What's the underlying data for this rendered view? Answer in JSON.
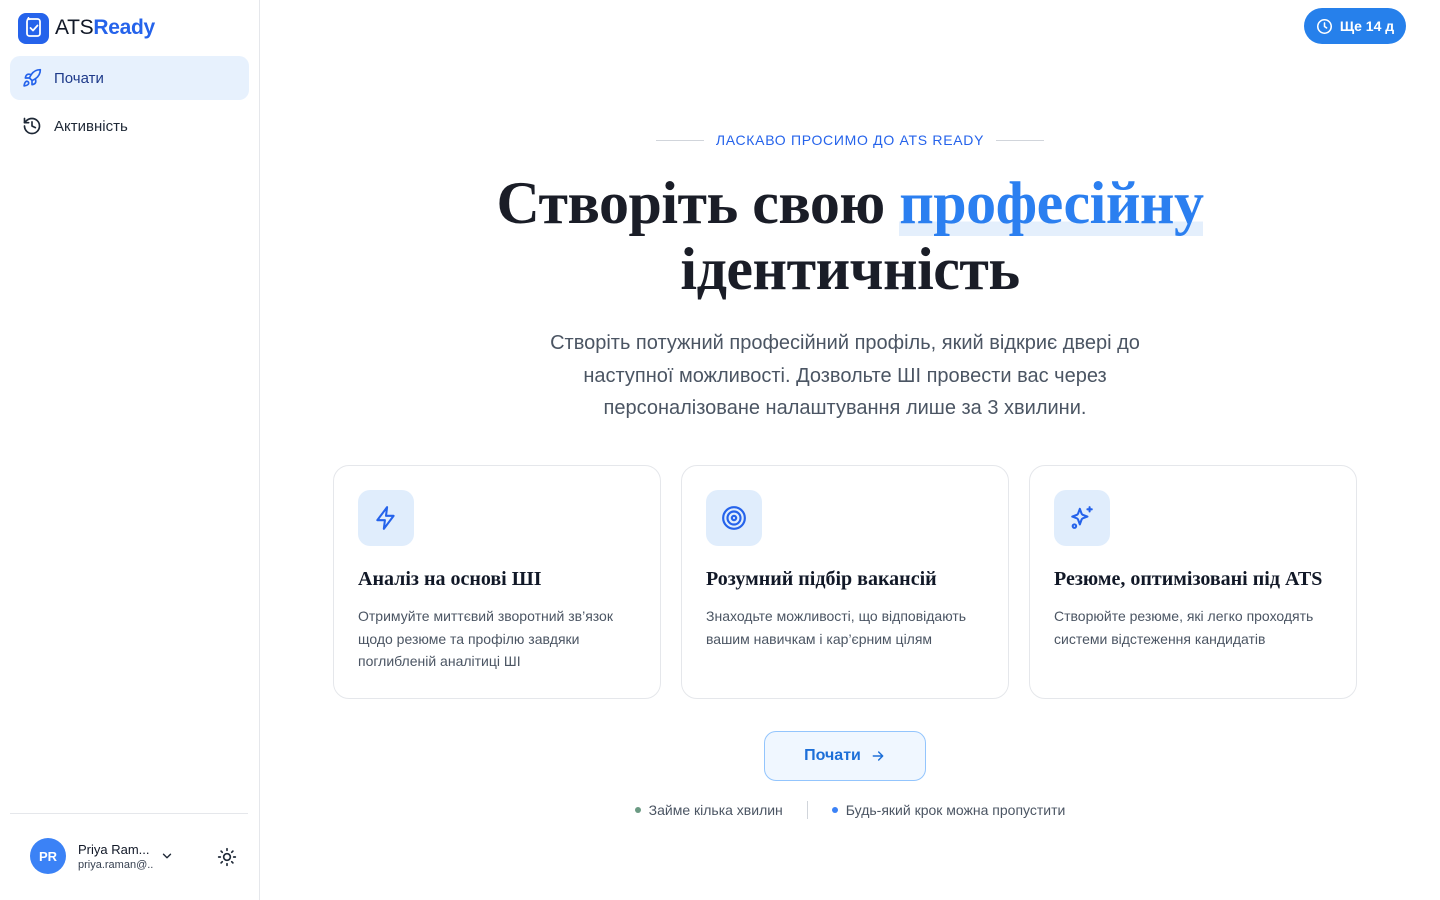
{
  "brand": {
    "name_part1": "ATS",
    "name_part2": "Ready",
    "color": "#2563eb"
  },
  "sidebar": {
    "items": [
      {
        "label": "Почати",
        "icon": "rocket-icon",
        "active": true
      },
      {
        "label": "Активність",
        "icon": "history-icon",
        "active": false
      }
    ]
  },
  "user": {
    "initials": "PR",
    "name": "Priya Ram...",
    "email": "priya.raman@...",
    "avatar_color": "#3b82f6"
  },
  "trial": {
    "label": "Ще 14 д",
    "icon": "clock-icon"
  },
  "hero": {
    "eyebrow": "ЛАСКАВО ПРОСИМО ДО ATS READY",
    "title_part1": "Створіть свою ",
    "title_accent": "професійну",
    "title_part2": "ідентичність",
    "subtitle": "Створіть потужний професійний профіль, який відкриє двері до наступної можливості. Дозвольте ШІ провести вас через персоналізоване налаштування лише за 3 хвилини."
  },
  "features": [
    {
      "icon": "lightning-icon",
      "title": "Аналіз на основі ШІ",
      "description": "Отримуйте миттєвий зворотний зв’язок щодо резюме та профілю завдяки поглибленій аналітиці ШІ"
    },
    {
      "icon": "target-icon",
      "title": "Розумний підбір вакансій",
      "description": "Знаходьте можливості, що відповідають вашим навичкам і кар’єрним цілям"
    },
    {
      "icon": "sparkles-icon",
      "title": "Резюме, оптимізовані під ATS",
      "description": "Створюйте резюме, які легко проходять системи відстеження кандидатів"
    }
  ],
  "cta": {
    "label": "Почати"
  },
  "footnotes": [
    {
      "text": "Займе кілька хвилин",
      "dot_color": "#6b9a83"
    },
    {
      "text": "Будь-який крок можна пропустити",
      "dot_color": "#3b82f6"
    }
  ],
  "colors": {
    "accent": "#2b7ff0",
    "trial_bg": "#2680eb",
    "active_nav_bg": "#e7f1fd"
  }
}
